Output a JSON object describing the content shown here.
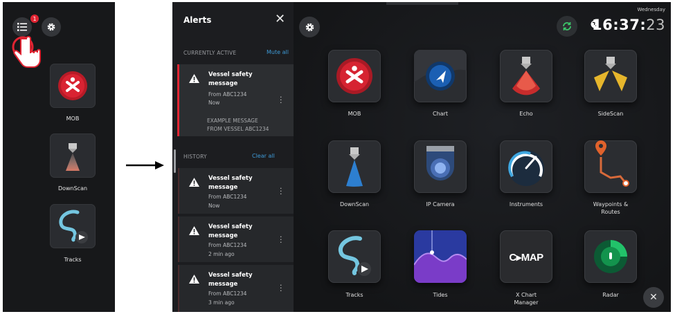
{
  "left_panel": {
    "menu_badge": "1",
    "tiles": [
      {
        "label": "MOB",
        "icon": "mob-icon"
      },
      {
        "label": "DownScan",
        "icon": "downscan-icon"
      },
      {
        "label": "Tracks",
        "icon": "tracks-icon"
      }
    ]
  },
  "alerts_panel": {
    "title": "Alerts",
    "currently_active_label": "CURRENTLY ACTIVE",
    "mute_all": "Mute all",
    "active": {
      "title": "Vessel safety message",
      "from": "From ABC1234",
      "time": "Now",
      "message_line1": "EXAMPLE MESSAGE",
      "message_line2": "FROM VESSEL ABC1234"
    },
    "history_label": "HISTORY",
    "clear_all": "Clear all",
    "history": [
      {
        "title": "Vessel safety message",
        "from": "From ABC1234",
        "time": "Now"
      },
      {
        "title": "Vessel safety message",
        "from": "From ABC1234",
        "time": "2 min ago"
      },
      {
        "title": "Vessel safety message",
        "from": "From ABC1234",
        "time": "3 min ago"
      }
    ]
  },
  "home": {
    "day": "Wednesday",
    "time_hm": "16:37:",
    "time_s": "23",
    "apps": [
      {
        "label": "MOB"
      },
      {
        "label": "Chart"
      },
      {
        "label": "Echo"
      },
      {
        "label": "SideScan"
      },
      {
        "label": "DownScan"
      },
      {
        "label": "IP Camera"
      },
      {
        "label": "Instruments"
      },
      {
        "label": "Waypoints &",
        "label2": "Routes"
      },
      {
        "label": "Tracks"
      },
      {
        "label": "Tides"
      },
      {
        "label": "X Chart",
        "label2": "Manager"
      },
      {
        "label": "Radar"
      }
    ],
    "cmap_logo": "C▸MAP"
  },
  "colors": {
    "accent_red": "#e02432",
    "link_blue": "#3e9ad6",
    "sync_green": "#3cc86a"
  }
}
